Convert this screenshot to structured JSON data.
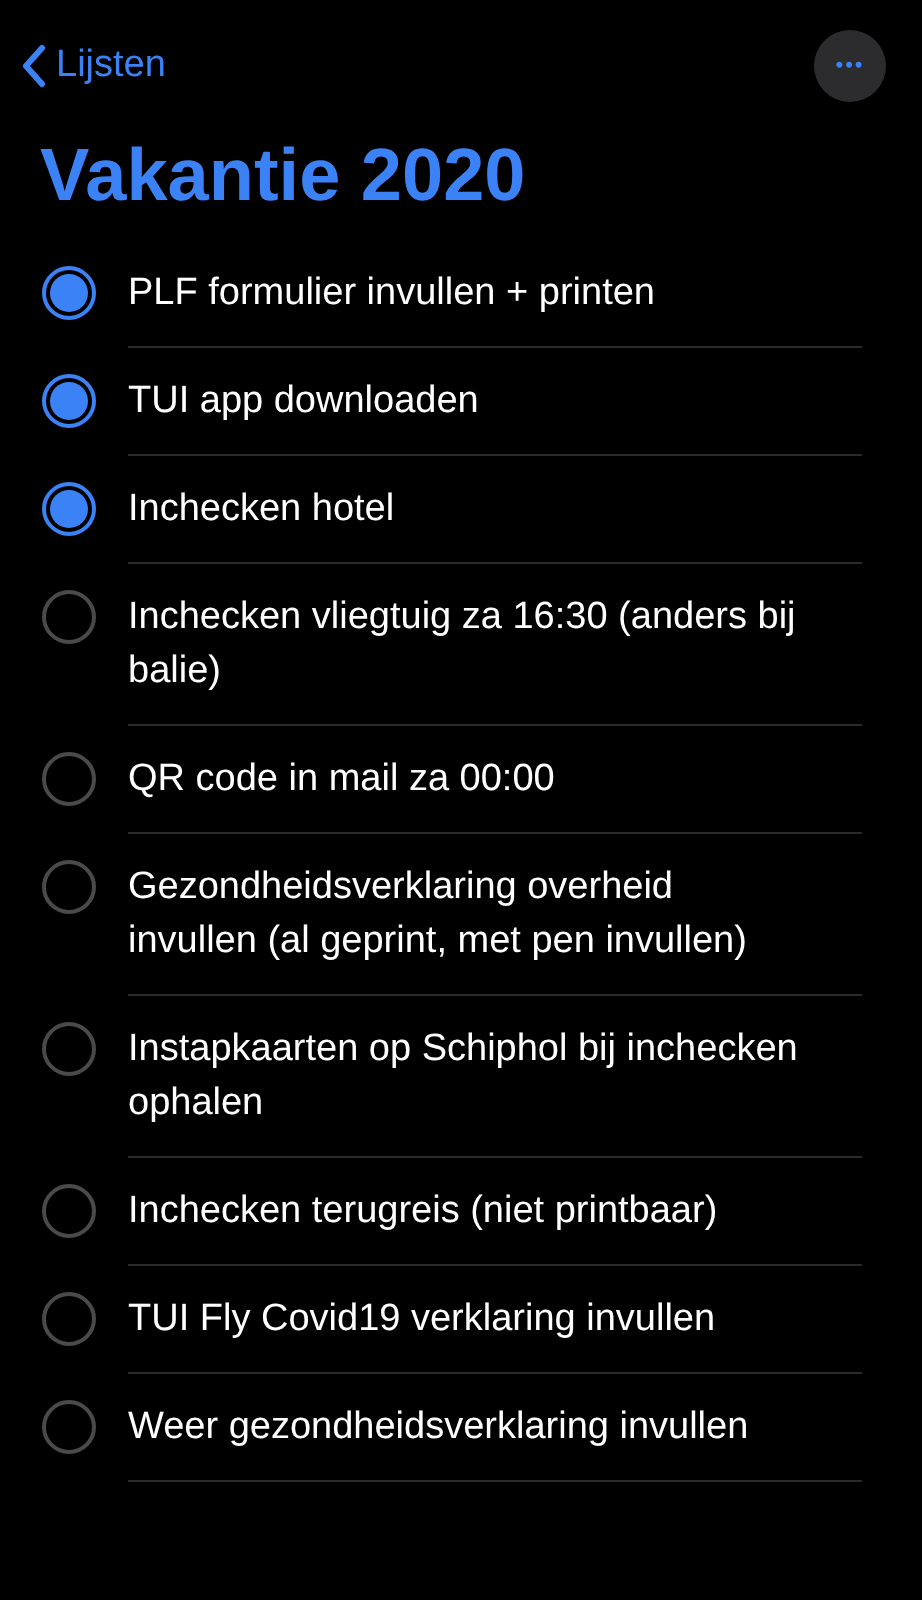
{
  "nav": {
    "back_label": "Lijsten",
    "more_label": "•••"
  },
  "title": "Vakantie 2020",
  "items": [
    {
      "text": "PLF formulier invullen + printen",
      "checked": true
    },
    {
      "text": "TUI app downloaden",
      "checked": true
    },
    {
      "text": "Inchecken hotel",
      "checked": true
    },
    {
      "text": "Inchecken vliegtuig za 16:30 (anders bij balie)",
      "checked": false
    },
    {
      "text": "QR code in mail za 00:00",
      "checked": false
    },
    {
      "text": "Gezondheidsverklaring overheid invullen (al geprint, met pen invullen)",
      "checked": false
    },
    {
      "text": "Instapkaarten op Schiphol bij inchecken ophalen",
      "checked": false
    },
    {
      "text": "Inchecken terugreis (niet printbaar)",
      "checked": false
    },
    {
      "text": "TUI Fly Covid19 verklaring invullen",
      "checked": false
    },
    {
      "text": "Weer gezondheidsverklaring invullen",
      "checked": false
    }
  ]
}
